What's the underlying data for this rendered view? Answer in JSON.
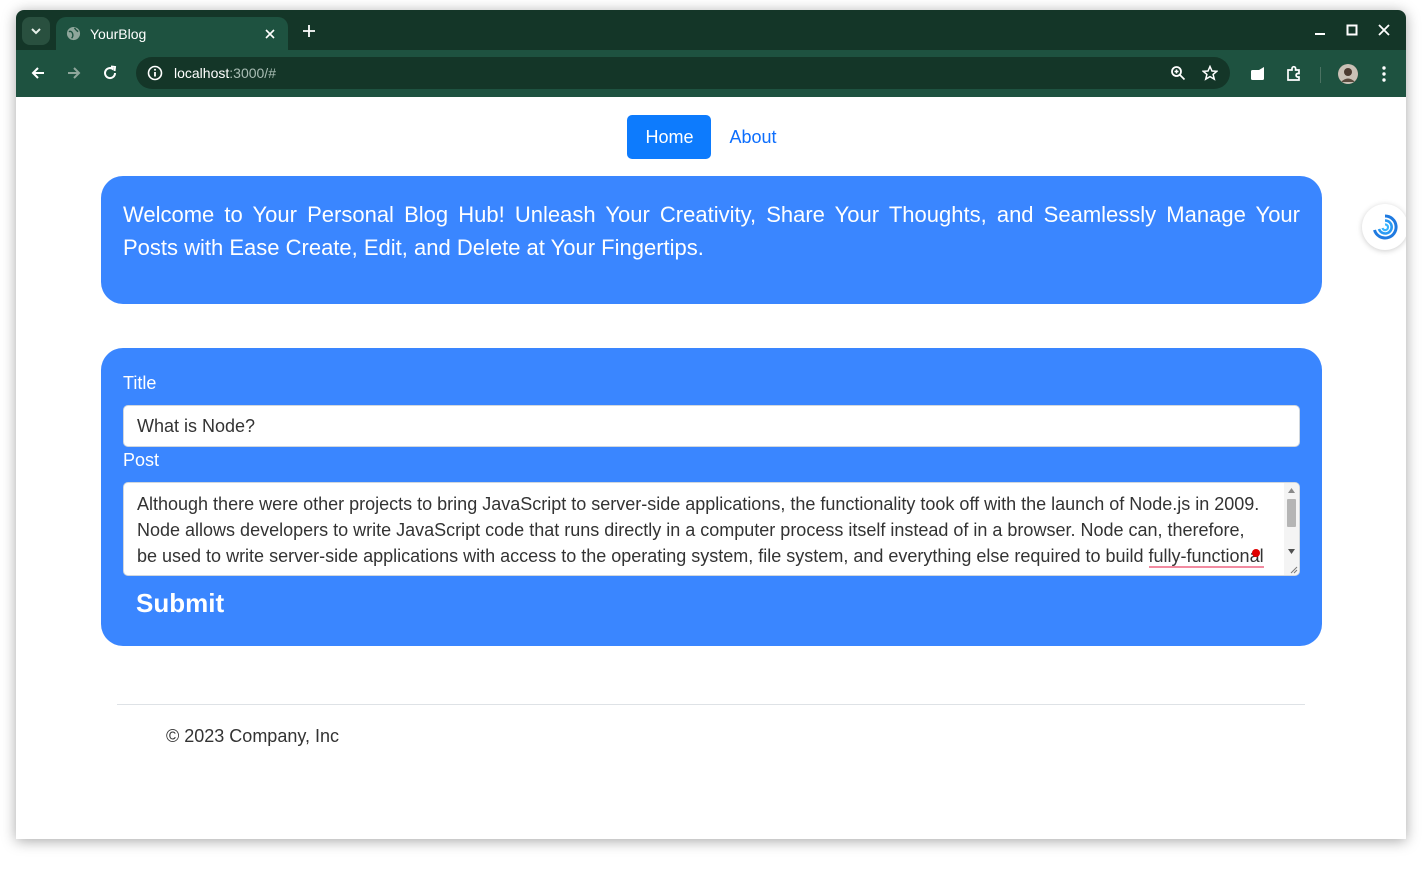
{
  "browser": {
    "tab": {
      "title": "YourBlog"
    },
    "address": {
      "host": "localhost",
      "rest": ":3000/#"
    }
  },
  "nav": {
    "links": [
      {
        "label": "Home",
        "active": true
      },
      {
        "label": "About",
        "active": false
      }
    ]
  },
  "hero": {
    "text": "Welcome to Your Personal Blog Hub! Unleash Your Creativity, Share Your Thoughts, and Seamlessly Manage Your Posts with Ease Create, Edit, and Delete at Your Fingertips."
  },
  "form": {
    "title_label": "Title",
    "title_value": "What is Node?",
    "post_label": "Post",
    "post_text_main": "Although there were other projects to bring JavaScript to server-side applications, the functionality took off with the launch of Node.js in 2009. Node allows developers to write JavaScript code that runs directly in a computer process itself instead of in a browser. Node can, therefore, be used to write server-side applications with access to the operating system, file system, and everything else required to build ",
    "post_text_flagged": "fully-functional",
    "submit_label": "Submit"
  },
  "footer": {
    "text": "© 2023 Company, Inc"
  },
  "colors": {
    "accent": "#3a86ff",
    "nav_active": "#0d7bfd",
    "browser_frame": "#143628",
    "browser_toolbar": "#1e5240"
  }
}
